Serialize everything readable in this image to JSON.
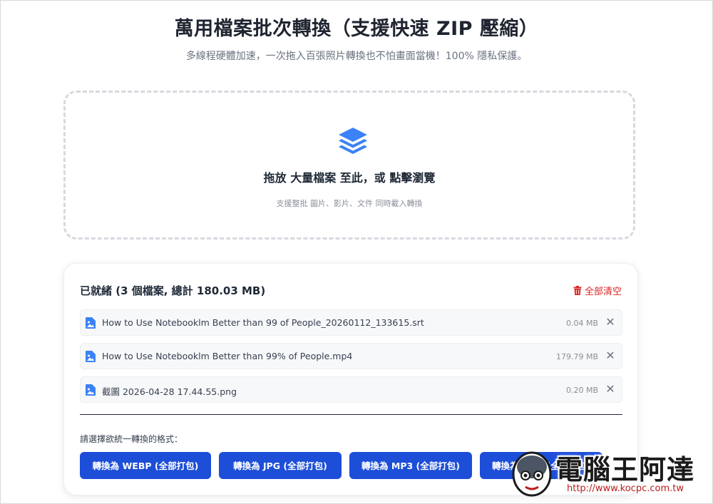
{
  "header": {
    "title": "萬用檔案批次轉換（支援快速 ZIP 壓縮）",
    "subtitle": "多線程硬體加速，一次拖入百張照片轉換也不怕畫面當機！100% 隱私保護。"
  },
  "dropzone": {
    "icon": "layers-icon",
    "main_text": "拖放 大量檔案 至此，或 點擊瀏覽",
    "sub_text": "支援整批 圖片、影片、文件 同時載入轉換"
  },
  "queue": {
    "status": "已就緒 (3 個檔案, 總計 180.03 MB)",
    "clear_label": "全部清空",
    "files": [
      {
        "name": "How to Use Notebooklm Better than 99 of People_20260112_133615.srt",
        "size": "0.04 MB"
      },
      {
        "name": "How to Use Notebooklm Better than 99% of People.mp4",
        "size": "179.79 MB"
      },
      {
        "name": "截圖 2026-04-28 17.44.55.png",
        "size": "0.20 MB"
      }
    ],
    "remove_symbol": "✕"
  },
  "formats": {
    "label": "請選擇欲統一轉換的格式：",
    "buttons": [
      "轉換為 WEBP (全部打包)",
      "轉換為 JPG (全部打包)",
      "轉換為 MP3 (全部打包)",
      "轉換為 MP4 (全部打包)"
    ]
  },
  "watermark": {
    "text": "電腦王阿達",
    "url": "http://www.kocpc.com.tw"
  },
  "colors": {
    "accent": "#1d4ed8",
    "danger": "#dc2626",
    "icon_blue": "#3b82f6"
  }
}
